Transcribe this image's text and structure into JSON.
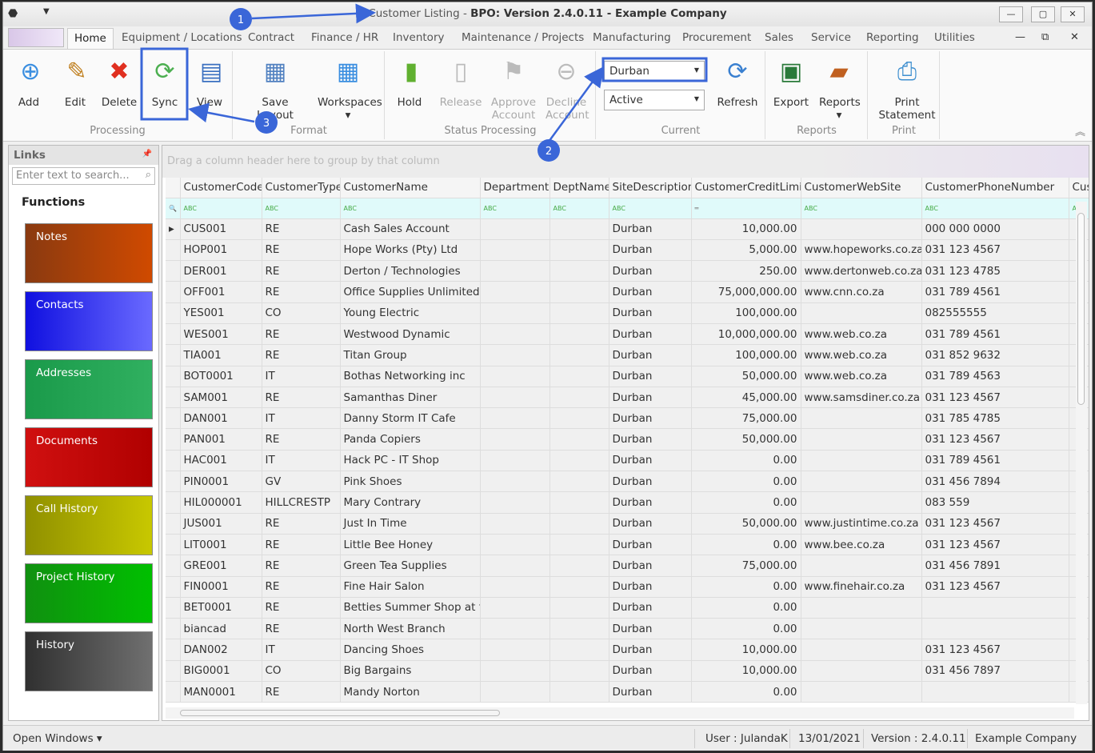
{
  "window": {
    "title_prefix": "Customer Listing - ",
    "title_bold": "BPO: Version 2.4.0.11 - Example Company"
  },
  "tabs": [
    "Home",
    "Equipment / Locations",
    "Contract",
    "Finance / HR",
    "Inventory",
    "Maintenance / Projects",
    "Manufacturing",
    "Procurement",
    "Sales",
    "Service",
    "Reporting",
    "Utilities"
  ],
  "ribbon": {
    "buttons": [
      {
        "label": "Add",
        "icon": "add-icon"
      },
      {
        "label": "Edit",
        "icon": "edit-icon"
      },
      {
        "label": "Delete",
        "icon": "delete-icon"
      },
      {
        "label": "Sync",
        "icon": "sync-icon"
      },
      {
        "label": "View",
        "icon": "view-icon"
      },
      {
        "label": "Save Layout",
        "icon": "save-layout-icon"
      },
      {
        "label": "Workspaces",
        "icon": "workspaces-icon"
      },
      {
        "label": "Hold",
        "icon": "hold-icon"
      },
      {
        "label": "Release",
        "icon": "release-icon",
        "disabled": true
      },
      {
        "label": "Approve Account",
        "icon": "approve-icon",
        "disabled": true
      },
      {
        "label": "Decline Account",
        "icon": "decline-icon",
        "disabled": true
      },
      {
        "label": "Refresh",
        "icon": "refresh-icon"
      },
      {
        "label": "Export",
        "icon": "export-icon"
      },
      {
        "label": "Reports",
        "icon": "reports-icon"
      },
      {
        "label": "Print Statement",
        "icon": "print-icon"
      }
    ],
    "groups": [
      "Processing",
      "Format",
      "Status Processing",
      "Current",
      "Reports",
      "Print"
    ],
    "site_combo": "Durban",
    "status_combo": "Active"
  },
  "links": {
    "title": "Links",
    "search_placeholder": "Enter text to search...",
    "functions_title": "Functions",
    "tiles": [
      {
        "label": "Notes",
        "c1": "#8a3a10",
        "c2": "#d04a00"
      },
      {
        "label": "Contacts",
        "c1": "#1010e0",
        "c2": "#6a6aff"
      },
      {
        "label": "Addresses",
        "c1": "#1a9a4a",
        "c2": "#30b060"
      },
      {
        "label": "Documents",
        "c1": "#d01010",
        "c2": "#b00000"
      },
      {
        "label": "Call History",
        "c1": "#909000",
        "c2": "#c8c800"
      },
      {
        "label": "Project History",
        "c1": "#109010",
        "c2": "#00c000"
      },
      {
        "label": "History",
        "c1": "#303030",
        "c2": "#707070"
      }
    ]
  },
  "grid": {
    "group_hint": "Drag a column header here to group by that column",
    "columns": [
      "CustomerCode",
      "CustomerType",
      "CustomerName",
      "Department",
      "DeptName",
      "SiteDescription",
      "CustomerCreditLimit",
      "CustomerWebSite",
      "CustomerPhoneNumber",
      "Cust"
    ],
    "rows": [
      [
        "CUS001",
        "RE",
        "Cash Sales Account",
        "",
        "",
        "Durban",
        "10,000.00",
        "",
        "000 000 0000"
      ],
      [
        "HOP001",
        "RE",
        "Hope Works (Pty) Ltd",
        "",
        "",
        "Durban",
        "5,000.00",
        "www.hopeworks.co.za",
        "031 123 4567"
      ],
      [
        "DER001",
        "RE",
        "Derton / Technologies",
        "",
        "",
        "Durban",
        "250.00",
        "www.dertonweb.co.za",
        "031 123 4785"
      ],
      [
        "OFF001",
        "RE",
        "Office Supplies Unlimited",
        "",
        "",
        "Durban",
        "75,000,000.00",
        "www.cnn.co.za",
        "031 789 4561"
      ],
      [
        "YES001",
        "CO",
        "Young Electric",
        "",
        "",
        "Durban",
        "100,000.00",
        "",
        "082555555"
      ],
      [
        "WES001",
        "RE",
        "Westwood Dynamic",
        "",
        "",
        "Durban",
        "10,000,000.00",
        "www.web.co.za",
        "031 789 4561"
      ],
      [
        "TIA001",
        "RE",
        "Titan Group",
        "",
        "",
        "Durban",
        "100,000.00",
        "www.web.co.za",
        "031 852 9632"
      ],
      [
        "BOT0001",
        "IT",
        "Bothas Networking inc",
        "",
        "",
        "Durban",
        "50,000.00",
        "www.web.co.za",
        "031 789 4563"
      ],
      [
        "SAM001",
        "RE",
        "Samanthas Diner",
        "",
        "",
        "Durban",
        "45,000.00",
        "www.samsdiner.co.za",
        "031 123 4567"
      ],
      [
        "DAN001",
        "IT",
        "Danny Storm IT Cafe",
        "",
        "",
        "Durban",
        "75,000.00",
        "",
        "031 785 4785"
      ],
      [
        "PAN001",
        "RE",
        "Panda Copiers",
        "",
        "",
        "Durban",
        "50,000.00",
        "",
        "031 123 4567"
      ],
      [
        "HAC001",
        "IT",
        "Hack PC - IT Shop",
        "",
        "",
        "Durban",
        "0.00",
        "",
        "031 789 4561"
      ],
      [
        "PIN0001",
        "GV",
        "Pink Shoes",
        "",
        "",
        "Durban",
        "0.00",
        "",
        "031 456 7894"
      ],
      [
        "HIL000001",
        "HILLCRESTP",
        "Mary Contrary",
        "",
        "",
        "Durban",
        "0.00",
        "",
        "083 559"
      ],
      [
        "JUS001",
        "RE",
        "Just In Time",
        "",
        "",
        "Durban",
        "50,000.00",
        "www.justintime.co.za",
        "031 123 4567"
      ],
      [
        "LIT0001",
        "RE",
        "Little Bee Honey",
        "",
        "",
        "Durban",
        "0.00",
        "www.bee.co.za",
        "031 123 4567"
      ],
      [
        "GRE001",
        "RE",
        "Green Tea Supplies",
        "",
        "",
        "Durban",
        "75,000.00",
        "",
        "031 456 7891"
      ],
      [
        "FIN0001",
        "RE",
        "Fine Hair Salon",
        "",
        "",
        "Durban",
        "0.00",
        "www.finehair.co.za",
        "031 123 4567"
      ],
      [
        "BET0001",
        "RE",
        "Betties Summer Shop at t...",
        "",
        "",
        "Durban",
        "0.00",
        "",
        ""
      ],
      [
        "biancad",
        "RE",
        "North West Branch",
        "",
        "",
        "Durban",
        "0.00",
        "",
        ""
      ],
      [
        "DAN002",
        "IT",
        "Dancing Shoes",
        "",
        "",
        "Durban",
        "10,000.00",
        "",
        "031 123 4567"
      ],
      [
        "BIG0001",
        "CO",
        "Big Bargains",
        "",
        "",
        "Durban",
        "10,000.00",
        "",
        "031 456 7897"
      ],
      [
        "MAN0001",
        "RE",
        "Mandy Norton",
        "",
        "",
        "Durban",
        "0.00",
        "",
        ""
      ]
    ]
  },
  "status": {
    "open_windows": "Open Windows ▾",
    "user": "User : JulandaK",
    "date": "13/01/2021",
    "version": "Version : 2.4.0.11",
    "company": "Example Company"
  },
  "annotations": [
    "1",
    "2",
    "3"
  ],
  "colors": {
    "annotation": "#3a66d8",
    "accent_green": "#4caf50"
  }
}
